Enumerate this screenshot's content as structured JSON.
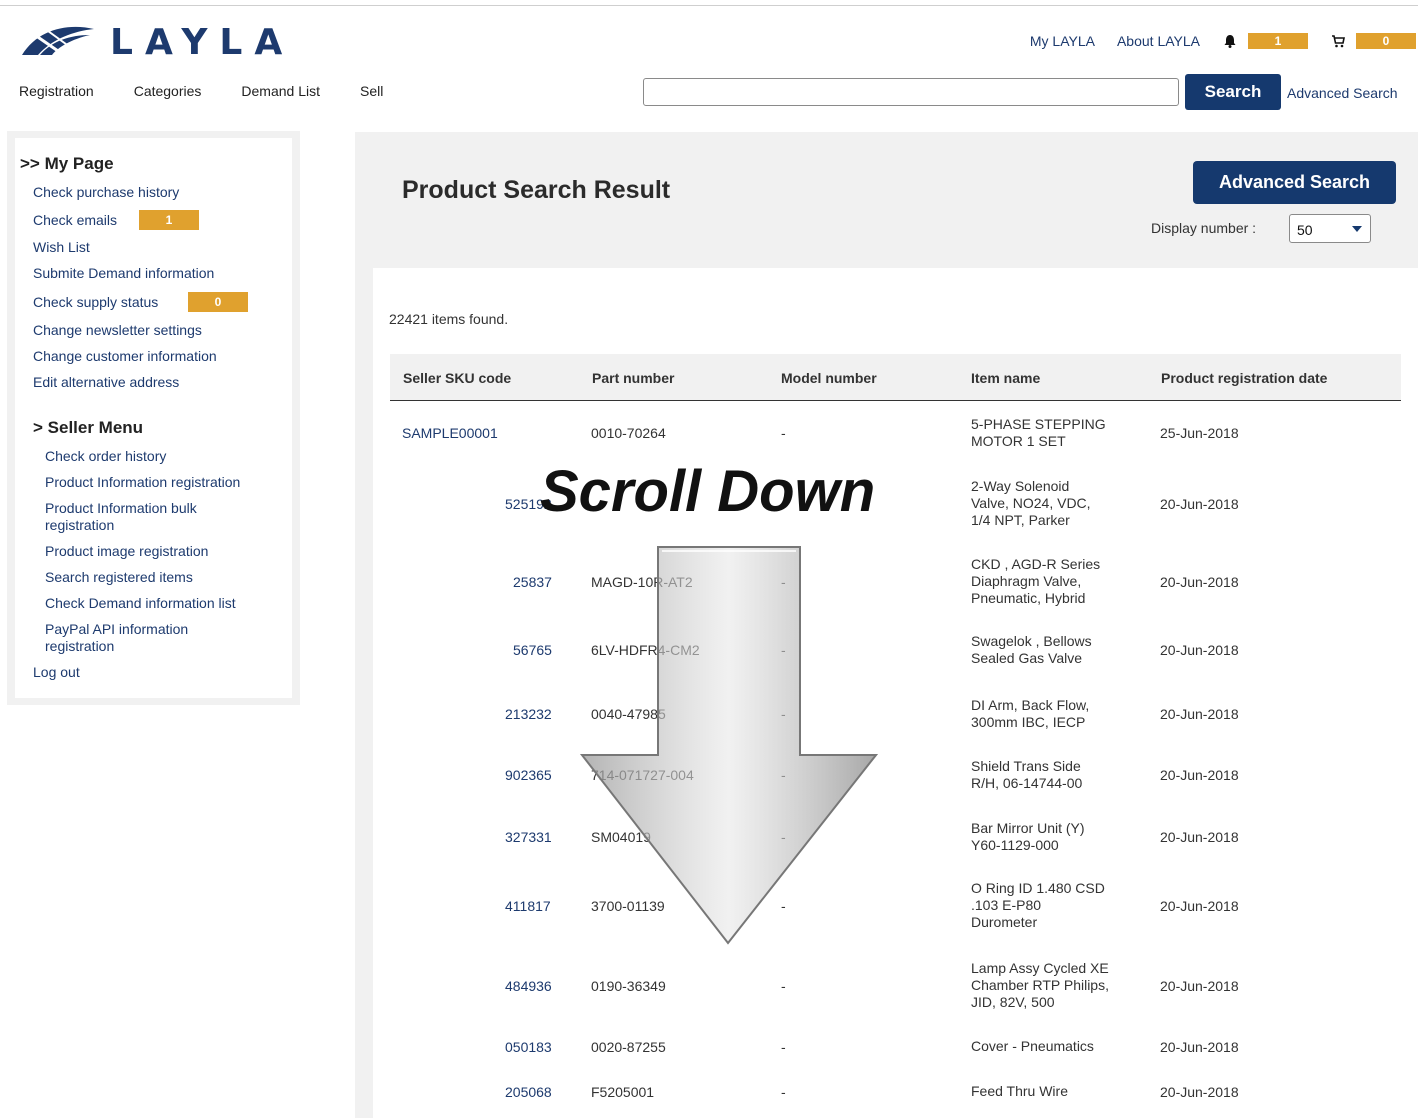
{
  "header": {
    "logo_text": "LAYLA",
    "links": {
      "my_layla": "My LAYLA",
      "about_layla": "About LAYLA"
    },
    "notification_count": "1",
    "cart_count": "0"
  },
  "nav": {
    "items": [
      "Registration",
      "Categories",
      "Demand List",
      "Sell"
    ],
    "search_button": "Search",
    "advanced_search_link": "Advanced Search",
    "search_value": ""
  },
  "sidebar": {
    "my_page_heading": ">> My Page",
    "my_page_items": [
      "Check purchase history",
      "Check emails",
      "Wish List",
      "Submite Demand information",
      "Check supply status",
      "Change newsletter settings",
      "Change customer information",
      "Edit alternative address"
    ],
    "emails_badge": "1",
    "supply_badge": "0",
    "seller_heading": "> Seller Menu",
    "seller_items": [
      "Check order history",
      "Product Information registration",
      "Product Information bulk registration",
      "Product image registration",
      "Search registered items",
      "Check Demand information list",
      "PayPal API information registration"
    ],
    "logout": "Log out"
  },
  "main": {
    "title": "Product Search Result",
    "advanced_search_button": "Advanced Search",
    "display_number_label": "Display number :",
    "display_number_value": "50",
    "items_found": "22421 items found."
  },
  "table": {
    "headers": [
      "Seller SKU code",
      "Part number",
      "Model number",
      "Item name",
      "Product registration date"
    ],
    "rows": [
      {
        "sku": "SAMPLE00001",
        "part": "0010-70264",
        "model": "-",
        "name": [
          "5-PHASE STEPPING",
          "MOTOR 1 SET"
        ],
        "date": "25-Jun-2018"
      },
      {
        "sku": "525192",
        "part": "",
        "model": "",
        "name": [
          "2-Way Solenoid",
          "Valve, NO24, VDC,",
          "1/4 NPT, Parker"
        ],
        "date": "20-Jun-2018"
      },
      {
        "sku": "25837",
        "part": "MAGD-10R-AT2",
        "model": "-",
        "name": [
          "CKD , AGD-R Series",
          "Diaphragm Valve,",
          "Pneumatic, Hybrid"
        ],
        "date": "20-Jun-2018"
      },
      {
        "sku": "56765",
        "part": "6LV-HDFR4-CM2",
        "model": "-",
        "name": [
          "Swagelok , Bellows",
          "Sealed Gas Valve"
        ],
        "date": "20-Jun-2018"
      },
      {
        "sku": "213232",
        "part": "0040-47985",
        "model": "-",
        "name": [
          "DI Arm, Back Flow,",
          "300mm IBC, IECP"
        ],
        "date": "20-Jun-2018"
      },
      {
        "sku": "902365",
        "part": "714-071727-004",
        "model": "-",
        "name": [
          "Shield Trans Side",
          "R/H, 06-14744-00"
        ],
        "date": "20-Jun-2018"
      },
      {
        "sku": "327331",
        "part": "SM04019",
        "model": "-",
        "name": [
          "Bar Mirror Unit (Y)",
          "Y60-1129-000"
        ],
        "date": "20-Jun-2018"
      },
      {
        "sku": "411817",
        "part": "3700-01139",
        "model": "-",
        "name": [
          "O Ring ID 1.480 CSD",
          ".103 E-P80",
          "Durometer"
        ],
        "date": "20-Jun-2018"
      },
      {
        "sku": "484936",
        "part": "0190-36349",
        "model": "-",
        "name": [
          "Lamp Assy Cycled XE",
          "Chamber RTP Philips,",
          "JID, 82V, 500"
        ],
        "date": "20-Jun-2018"
      },
      {
        "sku": "050183",
        "part": "0020-87255",
        "model": "-",
        "name": [
          "Cover - Pneumatics"
        ],
        "date": "20-Jun-2018"
      },
      {
        "sku": "205068",
        "part": "F5205001",
        "model": "-",
        "name": [
          "Feed Thru Wire"
        ],
        "date": "20-Jun-2018"
      }
    ]
  },
  "overlay": {
    "text": "Scroll Down"
  },
  "colors": {
    "brand_navy": "#15396e",
    "badge_orange": "#e0a12e",
    "panel_gray": "#f1f1f1"
  }
}
